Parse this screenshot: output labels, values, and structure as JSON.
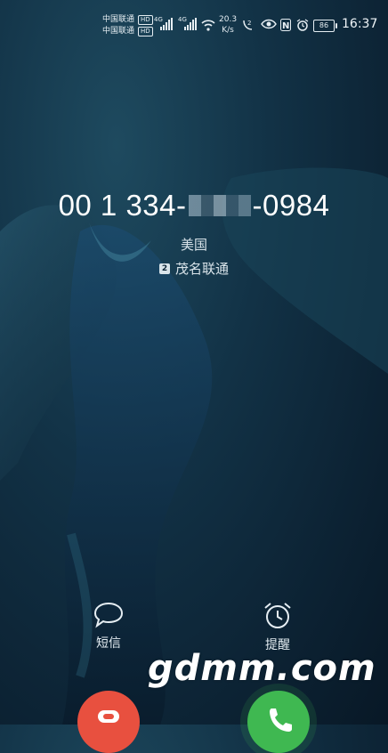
{
  "status_bar": {
    "carrier_1": "中国联通",
    "carrier_2": "中国联通",
    "hd_label": "HD",
    "network_1": "4G",
    "network_2": "4G",
    "speed_value": "20.3",
    "speed_unit": "K/s",
    "battery": "86",
    "time": "16:37"
  },
  "caller": {
    "number_prefix": "00 1 334-",
    "number_suffix": "-0984",
    "location": "美国",
    "sim_slot": "2",
    "sim_carrier": "茂名联通"
  },
  "actions": {
    "message_label": "短信",
    "reminder_label": "提醒"
  },
  "watermark": "gdmm.com",
  "colors": {
    "decline": "#e8503f",
    "answer": "#3fb851"
  }
}
